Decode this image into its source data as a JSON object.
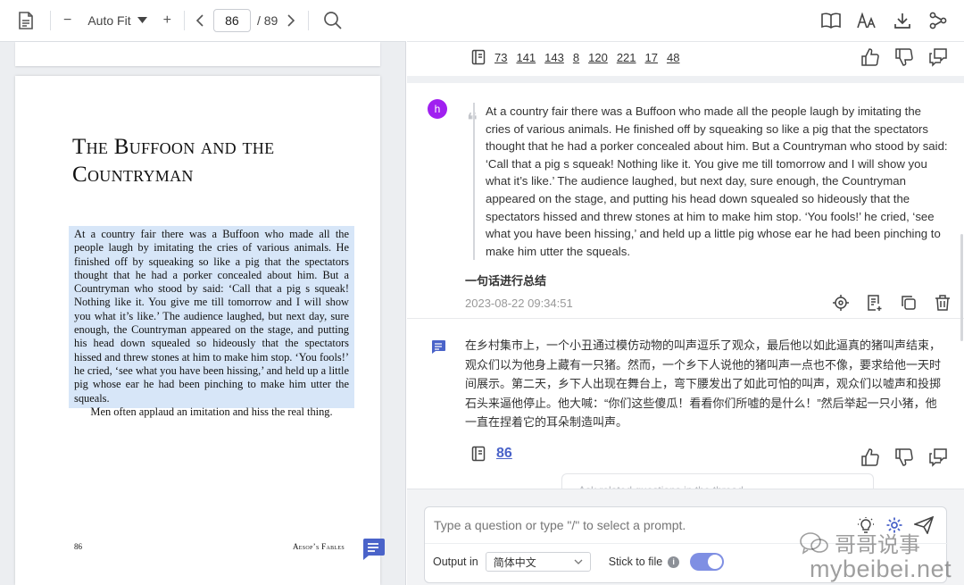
{
  "viewer": {
    "zoom_label": "Auto Fit",
    "current_page": "86",
    "total_pages": "/ 89"
  },
  "page": {
    "title_line1": "The Buffoon and the",
    "title_line2": "Countryman",
    "body": "At a country fair there was a Buffoon who made all the people laugh by imitating the cries of various animals. He finished off by squeaking so like a pig that the spectators thought that he had a porker concealed about him. But a Countryman who stood by said: ‘Call that a pig s squeak! Nothing like it. You give me till tomorrow and I will show you what it’s like.’ The audience laughed, but next day, sure enough, the Countryman appeared on the stage, and putting his head down squealed so hideously that the spectators hissed and threw stones at him to make him stop. ‘You fools!’ he cried, ‘see what you have been hissing,’ and held up a little pig whose ear he had been pinching to make him utter the squeals.",
    "moral": "Men often applaud an imitation and hiss the real thing.",
    "folio": "86",
    "running_head": "Aesop’s Fables"
  },
  "chat": {
    "refs_top": [
      "73",
      "141",
      "143",
      "8",
      "120",
      "221",
      "17",
      "48"
    ],
    "user_avatar": "h",
    "quote": "At a country fair there was a Buffoon who made all the people laugh by imitating the cries of various animals. He finished off by squeaking so like a pig that the spectators thought that he had a porker concealed about him. But a Countryman who stood by said: ‘Call that a pig s squeak! Nothing like it. You give me till tomorrow and I will show you what it’s like.’ The audience laughed, but next day, sure enough, the Countryman appeared on the stage, and putting his head down squealed so hideously that the spectators hissed and threw stones at him to make him stop. ‘You fools!’ he cried, ‘see what you have been hissing,’ and held up a little pig whose ear he had been pinching to make him utter the squeals.",
    "prompt_label": "一句话进行总结",
    "timestamp": "2023-08-22 09:34:51",
    "answer": "在乡村集市上，一个小丑通过模仿动物的叫声逗乐了观众，最后他以如此逼真的猪叫声结束，观众们以为他身上藏有一只猪。然而，一个乡下人说他的猪叫声一点也不像，要求给他一天时间展示。第二天，乡下人出现在舞台上，弯下腰发出了如此可怕的叫声，观众们以嘘声和投掷石头来逼他停止。他大喊：“你们这些傻瓜！看看你们所嘘的是什么！”然后举起一只小猪，他一直在捏着它的耳朵制造叫声。",
    "answer_ref": "86",
    "peek_text": "Ask related questions in the thread"
  },
  "composer": {
    "placeholder": "Type a question or type \"/\" to select a prompt.",
    "output_label": "Output in",
    "output_value": "简体中文",
    "stick_label": "Stick to file",
    "stick_on": true
  },
  "watermark": {
    "line1": "哥哥说事",
    "line2": "mybeibei.net"
  },
  "colors": {
    "highlight": "#d7e6f8",
    "accent": "#4a63c9",
    "avatar": "#a020f0",
    "toggle": "#7f8fe3"
  }
}
